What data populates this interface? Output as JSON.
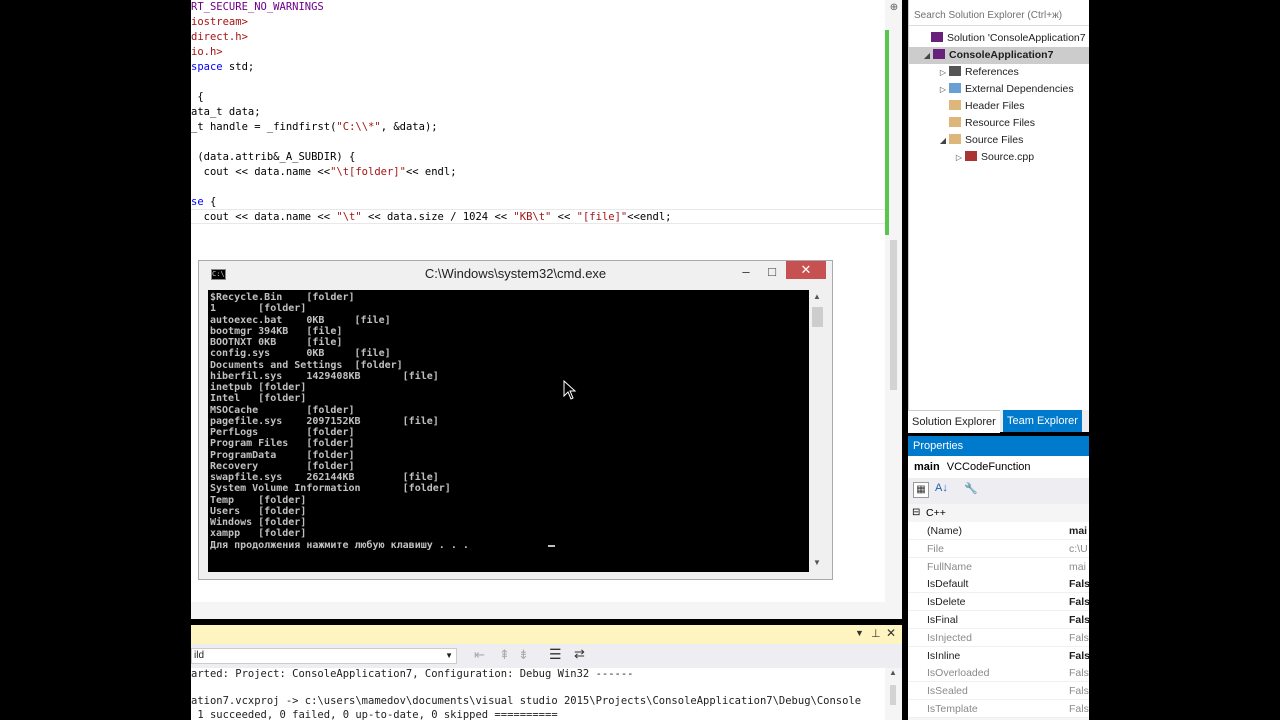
{
  "editor": {
    "lines": [
      {
        "parts": [
          {
            "t": "RT_SECURE_NO_WARNINGS",
            "c": "mac"
          }
        ]
      },
      {
        "parts": [
          {
            "t": "iostream>",
            "c": "str"
          }
        ]
      },
      {
        "parts": [
          {
            "t": "direct.h>",
            "c": "str"
          }
        ]
      },
      {
        "parts": [
          {
            "t": "io.h>",
            "c": "str"
          }
        ]
      },
      {
        "parts": [
          {
            "t": "space",
            "c": "kw"
          },
          {
            "t": " std;",
            "c": ""
          }
        ]
      },
      {
        "parts": []
      },
      {
        "parts": [
          {
            "t": " {",
            "c": ""
          }
        ]
      },
      {
        "parts": [
          {
            "t": "ata_t",
            "c": ""
          },
          {
            "t": " data;",
            "c": ""
          }
        ]
      },
      {
        "parts": [
          {
            "t": "_t",
            "c": ""
          },
          {
            "t": " handle = _findfirst(",
            "c": ""
          },
          {
            "t": "\"C:\\\\*\"",
            "c": "str"
          },
          {
            "t": ", &data);",
            "c": ""
          }
        ]
      },
      {
        "parts": []
      },
      {
        "parts": [
          {
            "t": " (data.attrib&_A_SUBDIR) {",
            "c": ""
          }
        ]
      },
      {
        "parts": [
          {
            "t": "  cout << data.name <<",
            "c": ""
          },
          {
            "t": "\"\\t[folder]\"",
            "c": "str"
          },
          {
            "t": "<< endl;",
            "c": ""
          }
        ]
      },
      {
        "parts": []
      },
      {
        "parts": [
          {
            "t": "se",
            "c": "kw"
          },
          {
            "t": " {",
            "c": ""
          }
        ]
      },
      {
        "parts": [
          {
            "t": "  cout << data.name << ",
            "c": ""
          },
          {
            "t": "\"\\t\"",
            "c": "str"
          },
          {
            "t": " << data.size / 1024 << ",
            "c": ""
          },
          {
            "t": "\"KB\\t\"",
            "c": "str"
          },
          {
            "t": " << ",
            "c": ""
          },
          {
            "t": "\"[file]\"",
            "c": "str"
          },
          {
            "t": "<<endl;",
            "c": ""
          }
        ]
      }
    ]
  },
  "cmd": {
    "title": "C:\\Windows\\system32\\cmd.exe",
    "minimize": "–",
    "maximize": "□",
    "close": "✕",
    "lines": [
      "$Recycle.Bin    [folder]",
      "1       [folder]",
      "autoexec.bat    0KB     [file]",
      "bootmgr 394KB   [file]",
      "BOOTNXT 0KB     [file]",
      "config.sys      0KB     [file]",
      "Documents and Settings  [folder]",
      "hiberfil.sys    1429408KB       [file]",
      "inetpub [folder]",
      "Intel   [folder]",
      "MSOCache        [folder]",
      "pagefile.sys    2097152KB       [file]",
      "PerfLogs        [folder]",
      "Program Files   [folder]",
      "ProgramData     [folder]",
      "Recovery        [folder]",
      "swapfile.sys    262144KB        [file]",
      "System Volume Information       [folder]",
      "Temp    [folder]",
      "Users   [folder]",
      "Windows [folder]",
      "xampp   [folder]",
      "Для продолжения нажмите любую клавишу . . ."
    ]
  },
  "output": {
    "source": "ild",
    "lines": [
      "arted: Project: ConsoleApplication7, Configuration: Debug Win32 ------",
      "",
      "ation7.vcxproj -> c:\\users\\mamedov\\documents\\visual studio 2015\\Projects\\ConsoleApplication7\\Debug\\Console",
      " 1 succeeded, 0 failed, 0 up-to-date, 0 skipped =========="
    ]
  },
  "solution_explorer": {
    "search_placeholder": "Search Solution Explorer (Ctrl+ж)",
    "items": [
      {
        "label": "Solution 'ConsoleApplication7",
        "arrow": "",
        "icon": "solution-icon",
        "bold": false
      },
      {
        "label": "ConsoleApplication7",
        "arrow": "◢",
        "icon": "project-icon",
        "bold": true
      },
      {
        "label": "References",
        "arrow": "▷",
        "icon": "references-icon",
        "bold": false
      },
      {
        "label": "External Dependencies",
        "arrow": "▷",
        "icon": "external-deps-icon",
        "bold": false
      },
      {
        "label": "Header Files",
        "arrow": "",
        "icon": "folder-icon",
        "bold": false
      },
      {
        "label": "Resource Files",
        "arrow": "",
        "icon": "folder-icon",
        "bold": false
      },
      {
        "label": "Source Files",
        "arrow": "◢",
        "icon": "folder-icon",
        "bold": false
      },
      {
        "label": "Source.cpp",
        "arrow": "▷",
        "icon": "cpp-file-icon",
        "bold": false
      }
    ],
    "tabs": [
      "Solution Explorer",
      "Team Explorer"
    ]
  },
  "properties": {
    "title": "Properties",
    "object_name": "main",
    "object_type": "VCCodeFunction",
    "category": "C++",
    "rows": [
      {
        "name": "(Name)",
        "value": "mai",
        "ro": false
      },
      {
        "name": "File",
        "value": "c:\\U",
        "ro": true
      },
      {
        "name": "FullName",
        "value": "mai",
        "ro": true
      },
      {
        "name": "IsDefault",
        "value": "Fals",
        "ro": false
      },
      {
        "name": "IsDelete",
        "value": "Fals",
        "ro": false
      },
      {
        "name": "IsFinal",
        "value": "Fals",
        "ro": false
      },
      {
        "name": "IsInjected",
        "value": "Fals",
        "ro": true
      },
      {
        "name": "IsInline",
        "value": "Fals",
        "ro": false
      },
      {
        "name": "IsOverloaded",
        "value": "Fals",
        "ro": true
      },
      {
        "name": "IsSealed",
        "value": "Fals",
        "ro": true
      },
      {
        "name": "IsTemplate",
        "value": "Fals",
        "ro": true
      }
    ]
  },
  "colors": {
    "accent": "#007acc",
    "console_bg": "#000000",
    "console_fg": "#c0c0c0",
    "close_red": "#c75050",
    "output_header": "#fdf4bf"
  }
}
